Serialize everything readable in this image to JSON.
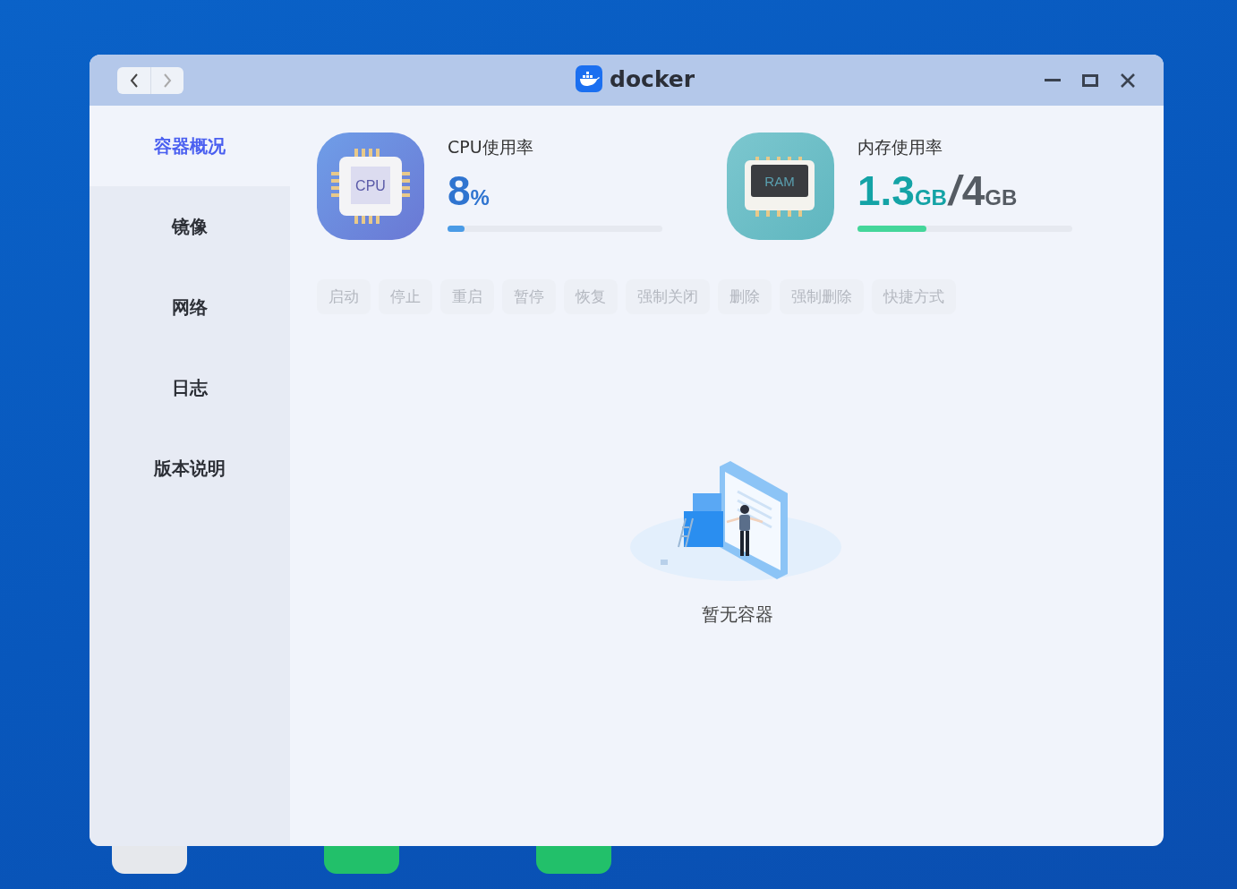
{
  "window": {
    "title": "docker"
  },
  "sidebar": {
    "items": [
      {
        "label": "容器概况",
        "selected": true
      },
      {
        "label": "镜像",
        "selected": false
      },
      {
        "label": "网络",
        "selected": false
      },
      {
        "label": "日志",
        "selected": false
      },
      {
        "label": "版本说明",
        "selected": false
      }
    ]
  },
  "cpu": {
    "label": "CPU使用率",
    "chip_text": "CPU",
    "value": "8",
    "unit": "%",
    "level": 0.08
  },
  "memory": {
    "label": "内存使用率",
    "chip_text": "RAM",
    "used": "1.3",
    "used_unit": "GB",
    "separator": "/",
    "total": "4",
    "total_unit": "GB",
    "level": 0.32
  },
  "actions": [
    {
      "label": "启动",
      "disabled": true
    },
    {
      "label": "停止",
      "disabled": true
    },
    {
      "label": "重启",
      "disabled": true
    },
    {
      "label": "暂停",
      "disabled": true
    },
    {
      "label": "恢复",
      "disabled": true
    },
    {
      "label": "强制关闭",
      "disabled": true
    },
    {
      "label": "删除",
      "disabled": true
    },
    {
      "label": "强制删除",
      "disabled": true
    },
    {
      "label": "快捷方式",
      "disabled": true
    }
  ],
  "empty_state": {
    "message": "暂无容器"
  }
}
